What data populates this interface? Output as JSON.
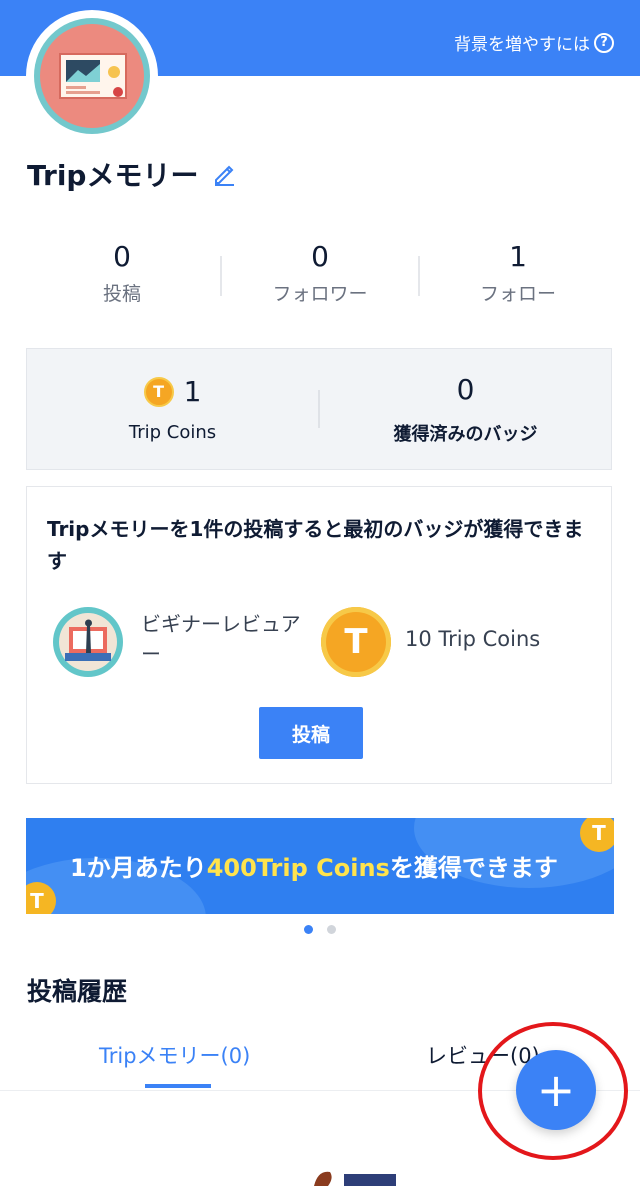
{
  "header": {
    "bg_link_label": "背景を増やすには",
    "help_icon": "question-circle-icon",
    "accent": "#3b82f6"
  },
  "profile": {
    "title": "Tripメモリー",
    "edit_icon": "pencil-icon"
  },
  "stats": [
    {
      "value": "0",
      "label": "投稿"
    },
    {
      "value": "0",
      "label": "フォロワー"
    },
    {
      "value": "1",
      "label": "フォロー"
    }
  ],
  "coins": {
    "value": "1",
    "label": "Trip Coins",
    "coin_glyph": "T"
  },
  "badges": {
    "value": "0",
    "label": "獲得済みのバッジ"
  },
  "mission": {
    "text": "Tripメモリーを1件の投稿すると最初のバッジが獲得できます",
    "badge_label": "ビギナーレビュアー",
    "coin_glyph": "T",
    "coin_label": "10 Trip Coins",
    "button_label": "投稿"
  },
  "banner": {
    "text_before": "1か月あたり",
    "text_highlight": "400Trip Coins",
    "text_after": "を獲得できます",
    "coin_glyph": "T"
  },
  "carousel": {
    "active_index": 0,
    "count": 2
  },
  "history": {
    "title": "投稿履歴",
    "tabs": [
      {
        "label": "Tripメモリー(0)",
        "active": true
      },
      {
        "label": "レビュー(0)",
        "active": false
      }
    ]
  },
  "fab": {
    "label": "+"
  }
}
